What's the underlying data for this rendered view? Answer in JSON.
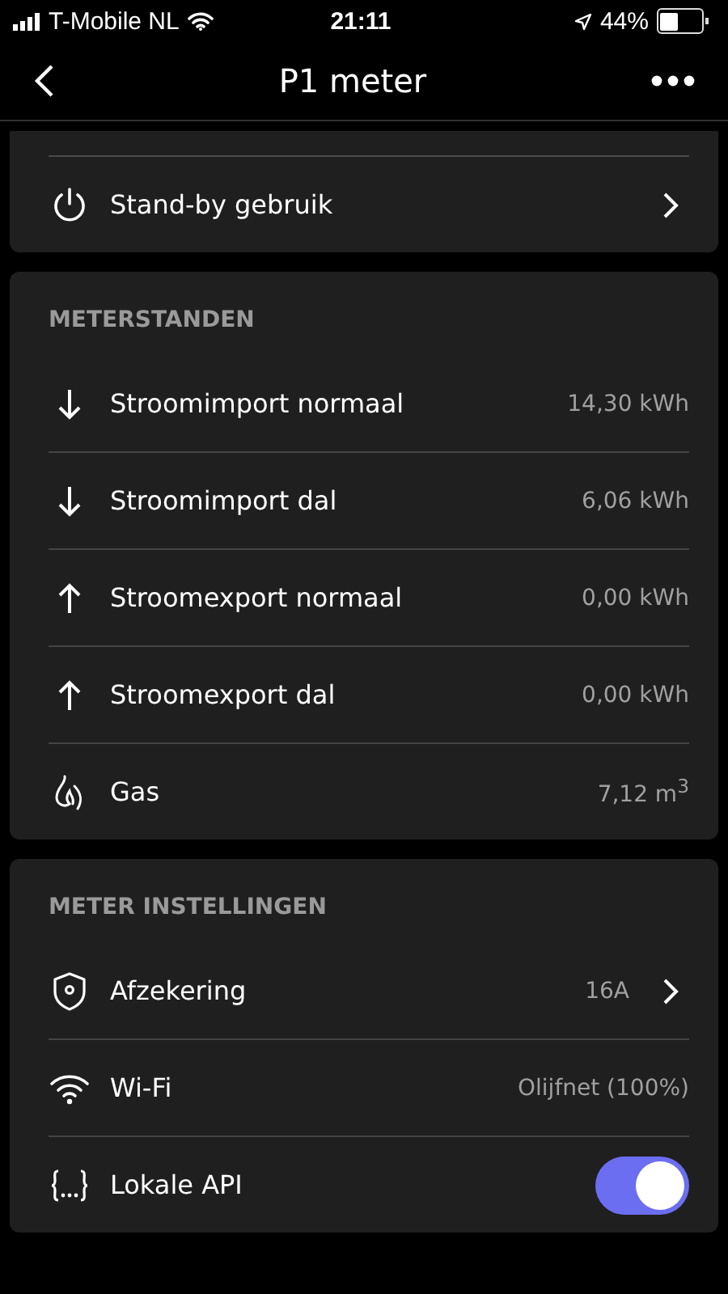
{
  "status_bar": {
    "carrier": "T-Mobile NL",
    "time": "21:11",
    "battery": "44%"
  },
  "nav": {
    "title": "P1 meter"
  },
  "top_card": {
    "rows": [
      {
        "kind": "nav",
        "label": "Stand-by gebruik"
      }
    ]
  },
  "meterstanden": {
    "header": "METERSTANDEN",
    "rows": [
      {
        "kind": "value",
        "label": "Stroomimport normaal",
        "value": "14,30 kWh"
      },
      {
        "kind": "value",
        "label": "Stroomimport dal",
        "value": "6,06 kWh"
      },
      {
        "kind": "value",
        "label": "Stroomexport normaal",
        "value": "0,00 kWh"
      },
      {
        "kind": "value",
        "label": "Stroomexport dal",
        "value": "0,00 kWh"
      },
      {
        "kind": "value",
        "label": "Gas",
        "value": "7,12 m$^{3}$"
      }
    ]
  },
  "instellingen": {
    "header": "METER INSTELLINGEN",
    "rows": [
      {
        "kind": "nav",
        "label": "Afzekering",
        "value": "16A"
      },
      {
        "kind": "value",
        "label": "Wi-Fi",
        "value": "Olijfnet (100%)"
      },
      {
        "kind": "toggle",
        "label": "Lokale API",
        "on": true
      }
    ]
  }
}
